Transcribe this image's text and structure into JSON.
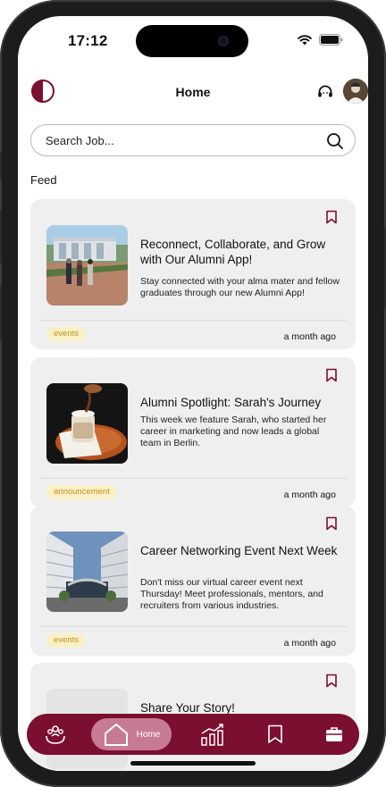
{
  "status": {
    "time": "17:12"
  },
  "header": {
    "title": "Home",
    "logo_icon": "half-circle-logo-icon",
    "support_icon": "headset-icon"
  },
  "search": {
    "placeholder": "Search Job..."
  },
  "feed": {
    "label": "Feed",
    "items": [
      {
        "title": "Reconnect, Collaborate, and Grow with Our Alumni App!",
        "description": "Stay connected with your alma mater and fellow graduates through our new Alumni App!",
        "tag": "events",
        "time": "a month ago"
      },
      {
        "title": "Alumni Spotlight: Sarah's Journey",
        "description": "This week we feature Sarah, who started her career in marketing and now leads a global team in Berlin.",
        "tag": "announcement",
        "time": "a month ago"
      },
      {
        "title": "Career Networking Event Next Week",
        "description": "Don't miss our virtual career event next Thursday! Meet professionals, mentors, and recruiters from various industries.",
        "tag": "events",
        "time": "a month ago"
      },
      {
        "title": "Share Your Story!"
      }
    ]
  },
  "nav": {
    "items": [
      {
        "icon": "community-icon"
      },
      {
        "icon": "home-icon",
        "label": "Home",
        "active": true
      },
      {
        "icon": "chart-icon"
      },
      {
        "icon": "bookmark-icon"
      },
      {
        "icon": "briefcase-icon"
      }
    ]
  },
  "colors": {
    "brand": "#7b0f30",
    "active_nav": "#c77b93",
    "tag_bg": "#faf0c8",
    "tag_text": "#c5921b",
    "card_bg": "#efefef"
  }
}
